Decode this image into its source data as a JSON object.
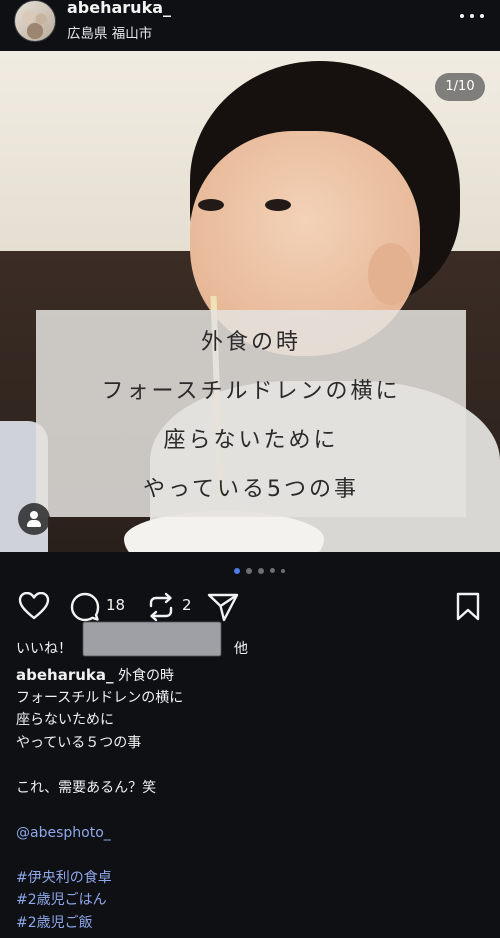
{
  "post": {
    "username": "abeharuka_",
    "location": "広島県 福山市",
    "image_counter": "1/10",
    "overlay_lines": [
      "外食の時",
      "フォースチルドレンの横に",
      "座らないために",
      "やっている5つの事"
    ],
    "carousel": {
      "total_visible_dots": 5,
      "active_index": 0
    }
  },
  "actions": {
    "like_icon": "heart-icon",
    "comment_icon": "comment-icon",
    "comment_count": "18",
    "repost_icon": "repost-icon",
    "repost_count": "2",
    "share_icon": "send-icon",
    "save_icon": "bookmark-icon"
  },
  "likes": {
    "prefix": "いいね！",
    "suffix": "他"
  },
  "caption": {
    "username": "abeharuka_",
    "first_line": "外食の時",
    "lines": [
      "フォースチルドレンの横に",
      "座らないために",
      "やっている５つの事",
      "",
      "これ、需要あるん？笑",
      ""
    ],
    "mention": "@abesphoto_",
    "blank": "",
    "hashtags": [
      "#伊央利の食卓",
      "#2歳児ごはん",
      "#2歳児ご飯"
    ]
  },
  "colors": {
    "background": "#0e1014",
    "link": "#8fa7ea",
    "active_dot": "#4f7be8"
  }
}
